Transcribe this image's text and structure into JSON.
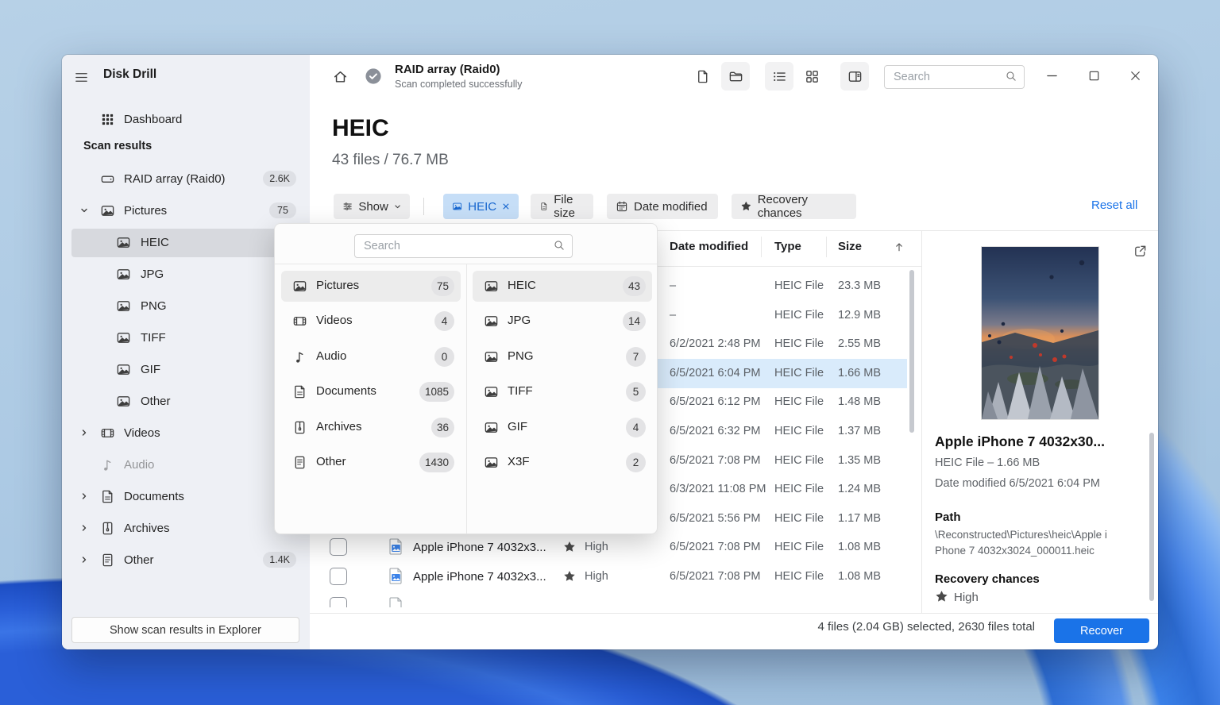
{
  "app": {
    "title": "Disk Drill"
  },
  "topbar": {
    "scan_title": "RAID array (Raid0)",
    "scan_status": "Scan completed successfully",
    "search_placeholder": "Search"
  },
  "sidebar": {
    "dashboard_label": "Dashboard",
    "section_label": "Scan results",
    "tree": [
      {
        "label": "RAID array (Raid0)",
        "badge": "2.6K"
      },
      {
        "label": "Pictures",
        "badge": "75"
      },
      {
        "label": "HEIC"
      },
      {
        "label": "JPG"
      },
      {
        "label": "PNG"
      },
      {
        "label": "TIFF"
      },
      {
        "label": "GIF"
      },
      {
        "label": "Other"
      },
      {
        "label": "Videos"
      },
      {
        "label": "Audio"
      },
      {
        "label": "Documents"
      },
      {
        "label": "Archives"
      },
      {
        "label": "Other",
        "badge": "1.4K"
      }
    ],
    "footer_button": "Show scan results in Explorer"
  },
  "content": {
    "title": "HEIC",
    "subtitle": "43 files / 76.7 MB",
    "filter": {
      "show": "Show",
      "chip": "HEIC",
      "file_size": "File size",
      "date_modified": "Date modified",
      "recovery_chances": "Recovery chances",
      "reset": "Reset all"
    }
  },
  "popover": {
    "search_placeholder": "Search",
    "categories": [
      {
        "label": "Pictures",
        "count": "75"
      },
      {
        "label": "Videos",
        "count": "4"
      },
      {
        "label": "Audio",
        "count": "0"
      },
      {
        "label": "Documents",
        "count": "1085"
      },
      {
        "label": "Archives",
        "count": "36"
      },
      {
        "label": "Other",
        "count": "1430"
      }
    ],
    "types": [
      {
        "label": "HEIC",
        "count": "43"
      },
      {
        "label": "JPG",
        "count": "14"
      },
      {
        "label": "PNG",
        "count": "7"
      },
      {
        "label": "TIFF",
        "count": "5"
      },
      {
        "label": "GIF",
        "count": "4"
      },
      {
        "label": "X3F",
        "count": "2"
      }
    ]
  },
  "table": {
    "headers": {
      "date": "Date modified",
      "type": "Type",
      "size": "Size"
    },
    "rows": [
      {
        "date": "–",
        "type": "HEIC File",
        "size": "23.3 MB"
      },
      {
        "date": "–",
        "type": "HEIC File",
        "size": "12.9 MB"
      },
      {
        "date": "6/2/2021 2:48 PM",
        "type": "HEIC File",
        "size": "2.55 MB"
      },
      {
        "date": "6/5/2021 6:04 PM",
        "type": "HEIC File",
        "size": "1.66 MB"
      },
      {
        "date": "6/5/2021 6:12 PM",
        "type": "HEIC File",
        "size": "1.48 MB"
      },
      {
        "date": "6/5/2021 6:32 PM",
        "type": "HEIC File",
        "size": "1.37 MB"
      },
      {
        "date": "6/5/2021 7:08 PM",
        "type": "HEIC File",
        "size": "1.35 MB"
      },
      {
        "date": "6/3/2021 11:08 PM",
        "type": "HEIC File",
        "size": "1.24 MB"
      },
      {
        "date": "6/5/2021 5:56 PM",
        "type": "HEIC File",
        "size": "1.17 MB"
      },
      {
        "date": "6/5/2021 7:08 PM",
        "type": "HEIC File",
        "size": "1.08 MB",
        "name": "Apple iPhone 7 4032x3...",
        "recovery": "High"
      },
      {
        "date": "6/5/2021 7:08 PM",
        "type": "HEIC File",
        "size": "1.08 MB",
        "name": "Apple iPhone 7 4032x3...",
        "recovery": "High"
      }
    ]
  },
  "preview": {
    "title": "Apple iPhone 7 4032x30...",
    "meta_type_size": "HEIC File – 1.66 MB",
    "meta_date": "Date modified 6/5/2021 6:04 PM",
    "path_label": "Path",
    "path_value": "\\Reconstructed\\Pictures\\heic\\Apple iPhone 7 4032x3024_000011.heic",
    "recovery_label": "Recovery chances",
    "recovery_value": "High"
  },
  "footer": {
    "summary": "4 files (2.04 GB) selected, 2630 files total",
    "recover": "Recover"
  },
  "colors": {
    "accent": "#1a73e8",
    "chip_bg": "#c6def7",
    "chip_fg": "#1766cf",
    "row_selected": "#d9ebfb",
    "sidebar_bg": "#eef0f5"
  }
}
